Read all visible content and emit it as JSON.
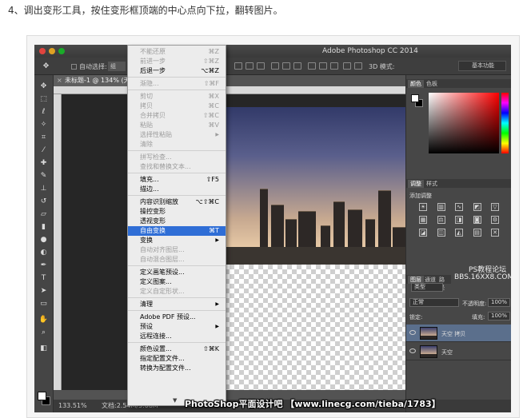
{
  "caption": "4、调出变形工具，按住变形框顶端的中心点向下拉，翻转图片。",
  "app": {
    "title": "Adobe Photoshop CC 2014"
  },
  "options_bar": {
    "auto_select_label": "自动选择:",
    "auto_select_value": "组",
    "mode_label": "3D 模式:",
    "workspace": "基本功能"
  },
  "document": {
    "tab_label": "未标题-1 @ 134% (天",
    "zoom": "133.51%",
    "doc_info": "文档:2.54M/5.08M"
  },
  "menu": {
    "items": [
      {
        "label": "不能还原",
        "shortcut": "⌘Z",
        "disabled": true
      },
      {
        "label": "前进一步",
        "shortcut": "⇧⌘Z",
        "disabled": true
      },
      {
        "label": "后退一步",
        "shortcut": "⌥⌘Z",
        "disabled": false
      },
      {
        "sep": true
      },
      {
        "label": "渐隐...",
        "shortcut": "⇧⌘F",
        "disabled": true
      },
      {
        "sep": true
      },
      {
        "label": "剪切",
        "shortcut": "⌘X",
        "disabled": true
      },
      {
        "label": "拷贝",
        "shortcut": "⌘C",
        "disabled": true
      },
      {
        "label": "合并拷贝",
        "shortcut": "⇧⌘C",
        "disabled": true
      },
      {
        "label": "粘贴",
        "shortcut": "⌘V",
        "disabled": true
      },
      {
        "label": "选择性粘贴",
        "submenu": true,
        "disabled": true
      },
      {
        "label": "清除",
        "disabled": true
      },
      {
        "sep": true
      },
      {
        "label": "拼写检查...",
        "disabled": true
      },
      {
        "label": "查找和替换文本...",
        "disabled": true
      },
      {
        "sep": true
      },
      {
        "label": "填充...",
        "shortcut": "⇧F5",
        "disabled": false
      },
      {
        "label": "描边...",
        "disabled": false
      },
      {
        "sep": true
      },
      {
        "label": "内容识别缩放",
        "shortcut": "⌥⇧⌘C",
        "disabled": false
      },
      {
        "label": "操控变形",
        "disabled": false
      },
      {
        "label": "透视变形",
        "disabled": false
      },
      {
        "label": "自由变换",
        "shortcut": "⌘T",
        "disabled": false,
        "highlighted": true
      },
      {
        "label": "变换",
        "submenu": true,
        "disabled": false
      },
      {
        "label": "自动对齐图层...",
        "disabled": true
      },
      {
        "label": "自动混合图层...",
        "disabled": true
      },
      {
        "sep": true
      },
      {
        "label": "定义画笔预设...",
        "disabled": false
      },
      {
        "label": "定义图案...",
        "disabled": false
      },
      {
        "label": "定义自定形状...",
        "disabled": true
      },
      {
        "sep": true
      },
      {
        "label": "清理",
        "submenu": true,
        "disabled": false
      },
      {
        "sep": true
      },
      {
        "label": "Adobe PDF 预设...",
        "disabled": false
      },
      {
        "label": "预设",
        "submenu": true,
        "disabled": false
      },
      {
        "label": "远程连接...",
        "disabled": false
      },
      {
        "sep": true
      },
      {
        "label": "颜色设置...",
        "shortcut": "⇧⌘K",
        "disabled": false
      },
      {
        "label": "指定配置文件...",
        "disabled": false
      },
      {
        "label": "转换为配置文件...",
        "disabled": false
      }
    ],
    "more_arrow": "▼"
  },
  "panels": {
    "color_tabs": [
      "颜色",
      "色板"
    ],
    "adjust_tabs": [
      "调整",
      "样式"
    ],
    "adjust_title": "添加调整",
    "layers_tabs": [
      "图层",
      "通道",
      "路径"
    ],
    "filter_kind": "类型",
    "blend_mode": "正常",
    "opacity_label": "不透明度:",
    "opacity_value": "100%",
    "lock_label": "锁定:",
    "fill_label": "填充:",
    "fill_value": "100%",
    "layers": [
      {
        "name": "天空 拷贝",
        "selected": true
      },
      {
        "name": "天空",
        "selected": false
      }
    ]
  },
  "watermarks": {
    "site_cn": "PS教程论坛",
    "site_url": "BBS.16XX8.COM",
    "banner": "PhotoShop平面设计吧 【www.linecg.com/tieba/1783】"
  },
  "colors": {
    "menu_highlight": "#2f6ed6",
    "layer_selected": "#5b6f8c",
    "app_bg": "#535353"
  }
}
